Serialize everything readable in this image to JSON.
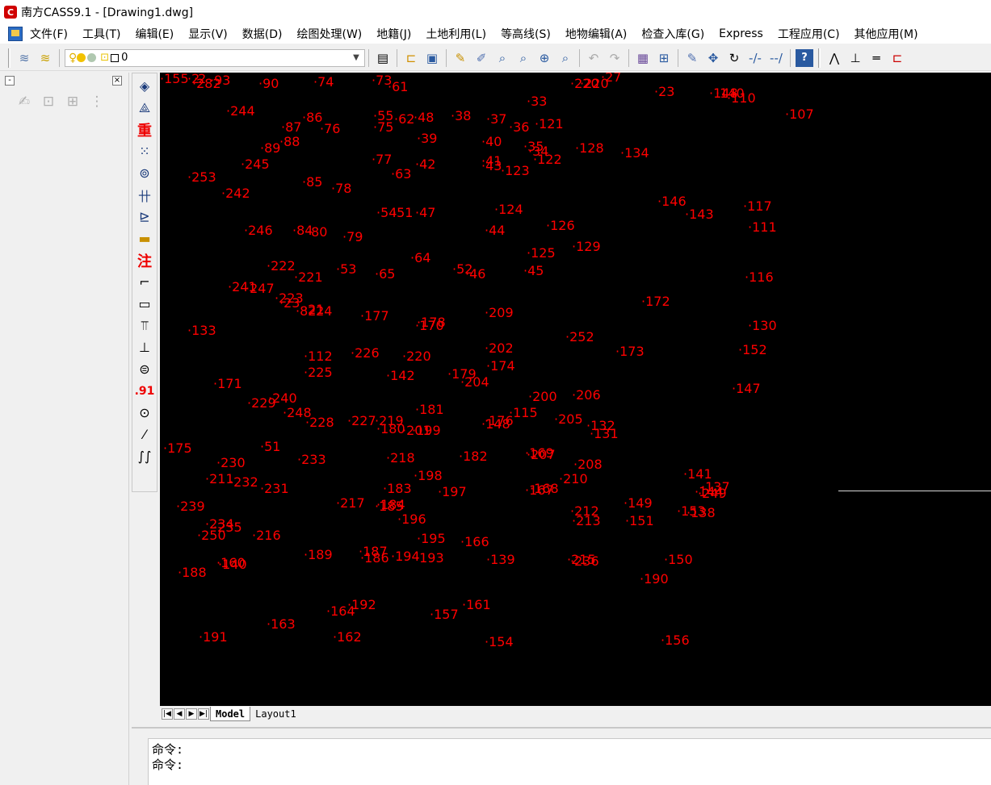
{
  "window": {
    "title": "南方CASS9.1 - [Drawing1.dwg]",
    "icon_text": "C"
  },
  "menu": [
    "文件(F)",
    "工具(T)",
    "编辑(E)",
    "显示(V)",
    "数据(D)",
    "绘图处理(W)",
    "地籍(J)",
    "土地利用(L)",
    "等高线(S)",
    "地物编辑(A)",
    "检查入库(G)",
    "Express",
    "工程应用(C)",
    "其他应用(M)"
  ],
  "layer": {
    "name": "0",
    "sun_color": "#f2c200",
    "lock_color": "#e8c000"
  },
  "tabs": {
    "model": "Model",
    "layout": "Layout1"
  },
  "command_lines": [
    "命令:",
    "命令:"
  ],
  "point_color": "#ff0000",
  "points": [
    "2",
    "2",
    "282",
    "93",
    "90",
    "74",
    "73",
    "61",
    "220",
    "220",
    "27",
    "23",
    "148",
    "140",
    "110",
    "107",
    "244",
    "86",
    "87",
    "76",
    "55",
    "62",
    "48",
    "38",
    "37",
    "36",
    "121",
    "33",
    "75",
    "89",
    "88",
    "39",
    "40",
    "35",
    "34",
    "128",
    "134",
    "245",
    "77",
    "42",
    "41",
    "43",
    "123",
    "122",
    "253",
    "242",
    "63",
    "85",
    "78",
    "54",
    "51",
    "47",
    "124",
    "146",
    "143",
    "117",
    "111",
    "246",
    "84",
    "80",
    "79",
    "44",
    "126",
    "129",
    "125",
    "64",
    "222",
    "221",
    "53",
    "65",
    "52",
    "46",
    "45",
    "116",
    "241",
    "247",
    "223",
    "23",
    "82",
    "21",
    "24",
    "177",
    "178",
    "170",
    "209",
    "172",
    "133",
    "252",
    "130",
    "112",
    "225",
    "226",
    "220",
    "202",
    "174",
    "173",
    "152",
    "142",
    "179",
    "204",
    "171",
    "240",
    "229",
    "248",
    "228",
    "227",
    "219",
    "180",
    "181",
    "201",
    "199",
    "200",
    "206",
    "147",
    "115",
    "205",
    "132",
    "131",
    "148",
    "176",
    "175",
    "51",
    "230",
    "233",
    "218",
    "182",
    "169",
    "207",
    "208",
    "211",
    "232",
    "231",
    "198",
    "183",
    "197",
    "167",
    "168",
    "210",
    "141",
    "137",
    "144",
    "249",
    "239",
    "217",
    "184",
    "185",
    "196",
    "212",
    "213",
    "149",
    "153",
    "138",
    "151",
    "234",
    "235",
    "250",
    "216",
    "195",
    "166",
    "189",
    "187",
    "186",
    "194",
    "193",
    "139",
    "150",
    "215",
    "236",
    "160",
    "140",
    "188",
    "190",
    "192",
    "164",
    "157",
    "161",
    "162",
    "191",
    "163",
    "154",
    "156",
    "155"
  ]
}
